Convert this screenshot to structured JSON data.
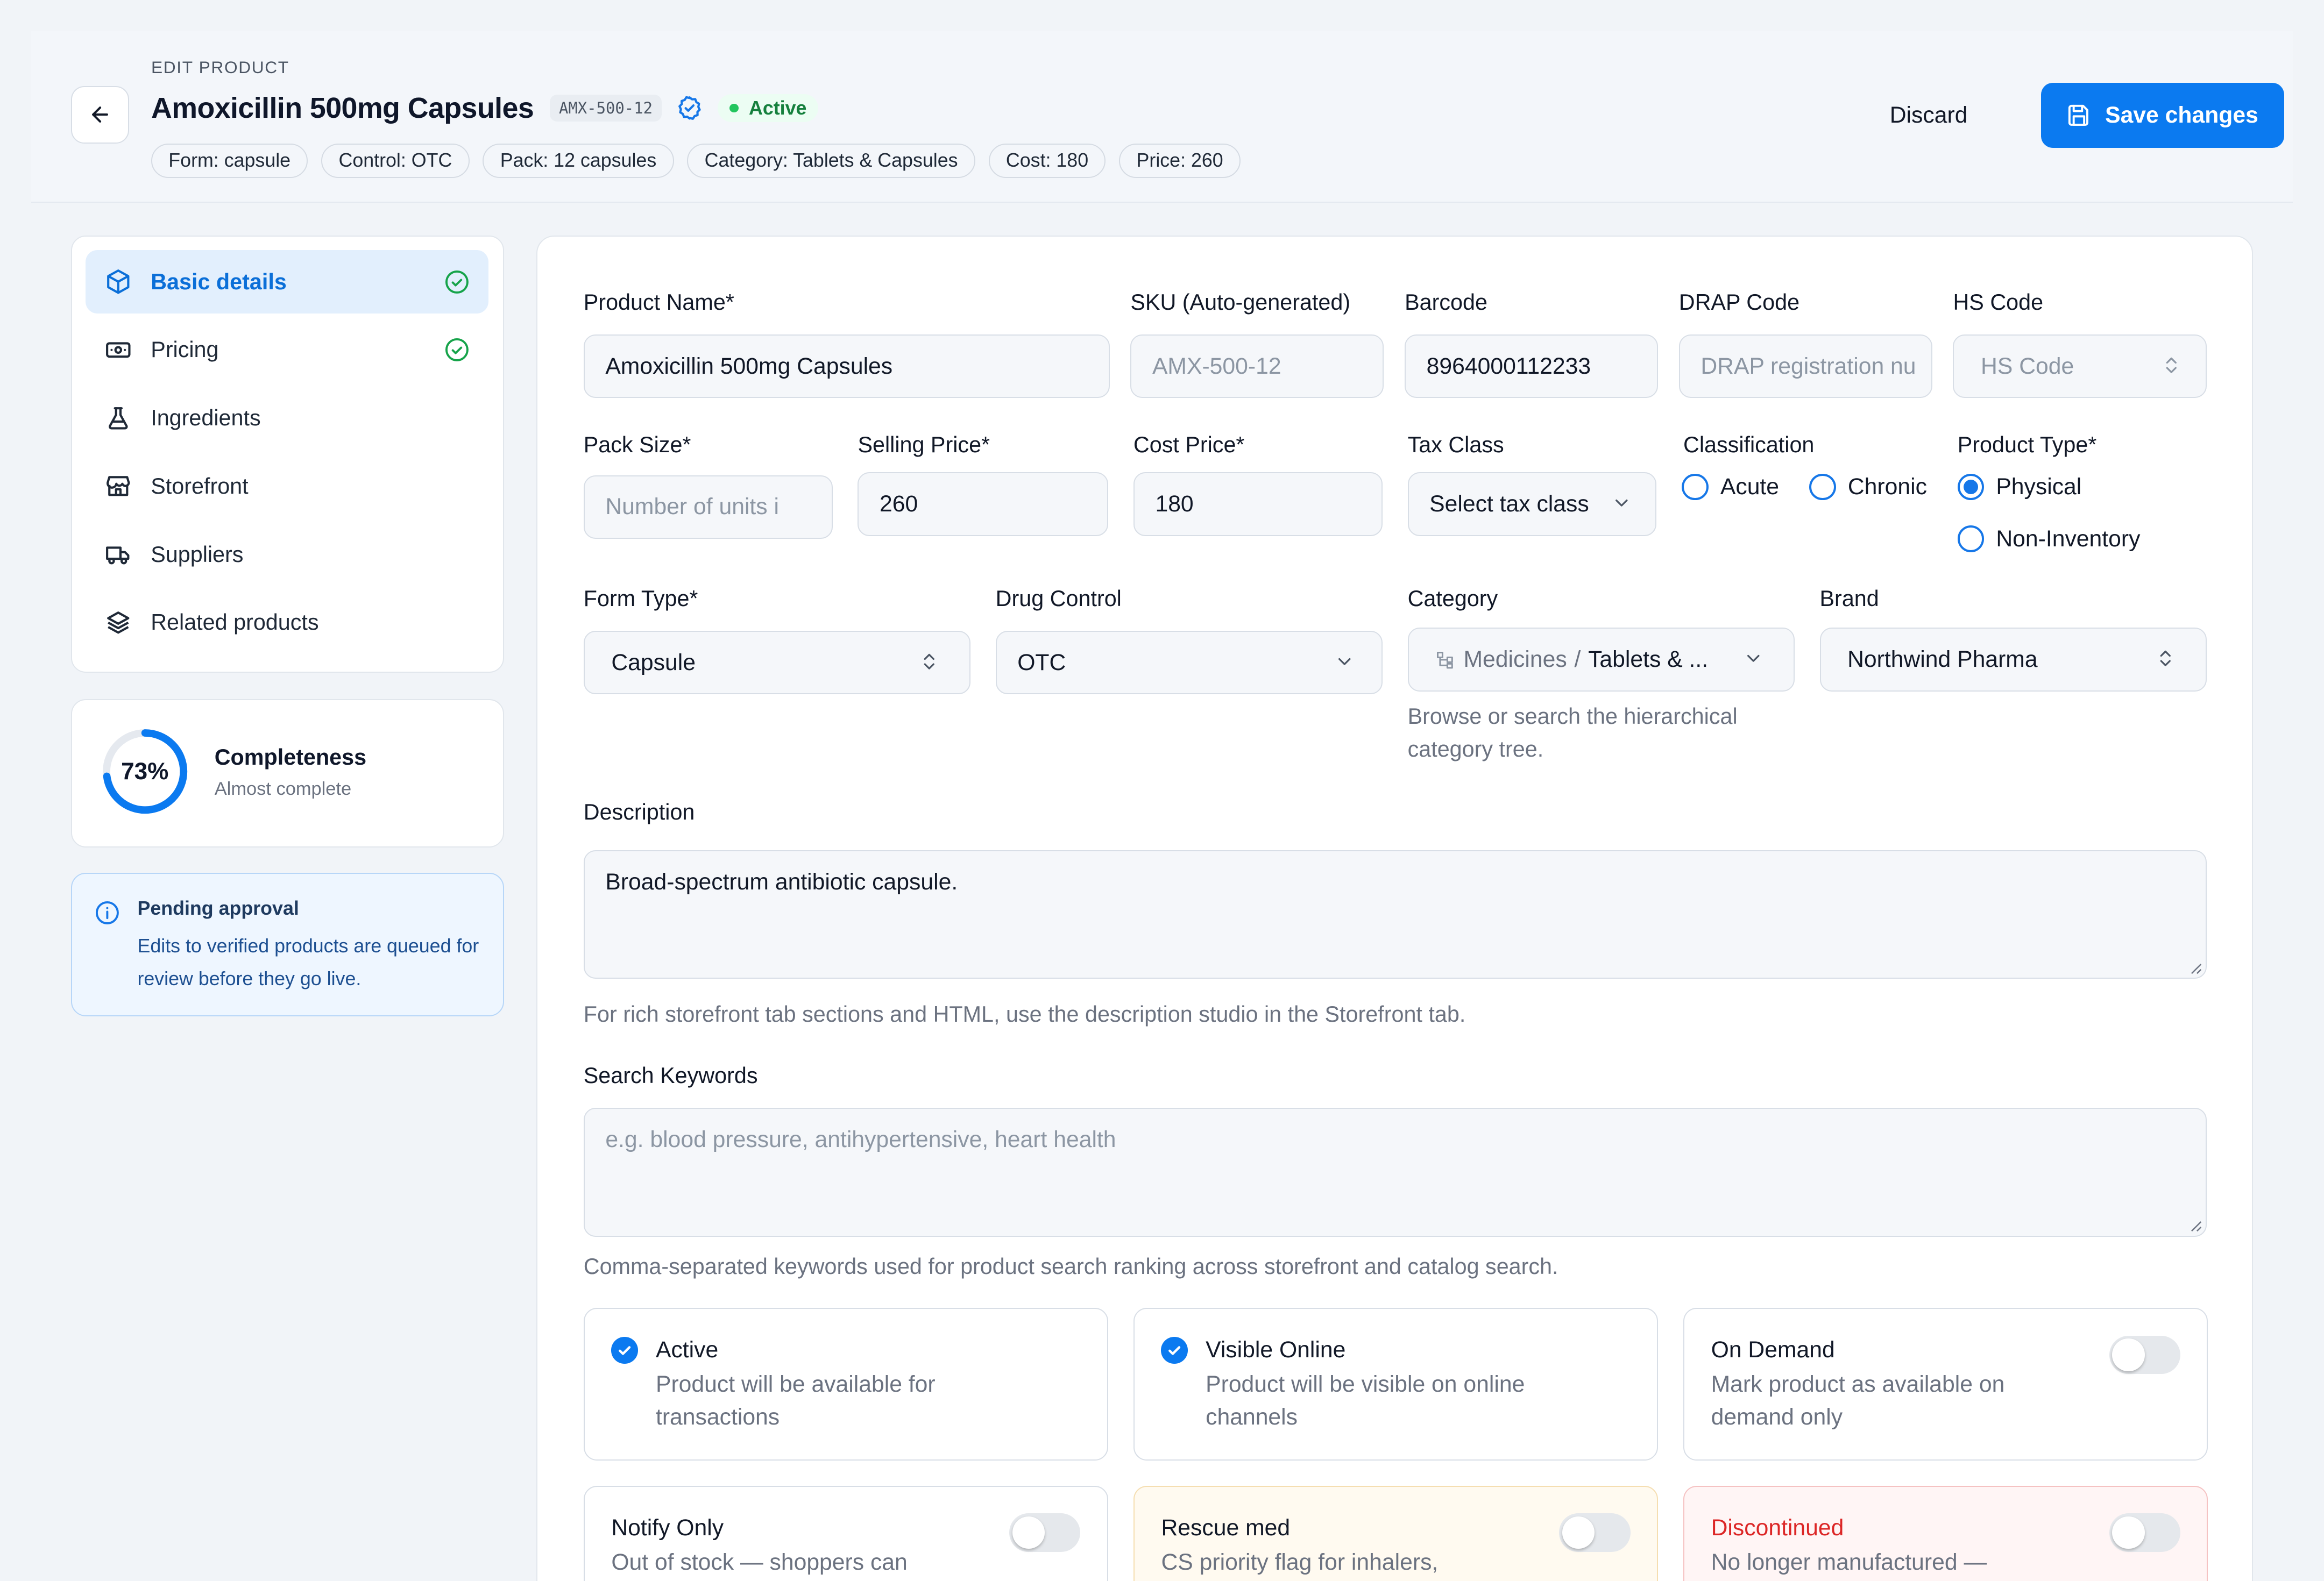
{
  "header": {
    "eyebrow": "EDIT PRODUCT",
    "title": "Amoxicillin 500mg Capsules",
    "sku_badge": "AMX-500-12",
    "status": "Active",
    "chips": [
      "Form: capsule",
      "Control: OTC",
      "Pack: 12 capsules",
      "Category: Tablets & Capsules",
      "Cost: 180",
      "Price: 260"
    ],
    "discard_label": "Discard",
    "save_label": "Save changes",
    "icons": {
      "back": "arrow-left-icon",
      "verified": "verified-badge-icon",
      "save": "save-disk-icon"
    }
  },
  "sidebar": {
    "items": [
      {
        "label": "Basic details",
        "icon": "cube-icon",
        "active": true,
        "complete": true
      },
      {
        "label": "Pricing",
        "icon": "banknote-icon",
        "active": false,
        "complete": true
      },
      {
        "label": "Ingredients",
        "icon": "flask-icon",
        "active": false,
        "complete": false
      },
      {
        "label": "Storefront",
        "icon": "store-icon",
        "active": false,
        "complete": false
      },
      {
        "label": "Suppliers",
        "icon": "truck-icon",
        "active": false,
        "complete": false
      },
      {
        "label": "Related products",
        "icon": "layers-icon",
        "active": false,
        "complete": false
      }
    ]
  },
  "completeness": {
    "percent_label": "73%",
    "percent": 73,
    "title": "Completeness",
    "subtitle": "Almost complete"
  },
  "pending": {
    "title": "Pending approval",
    "text": "Edits to verified products are queued for review before they go live."
  },
  "form": {
    "product_name": {
      "label": "Product Name*",
      "value": "Amoxicillin 500mg Capsules"
    },
    "sku": {
      "label": "SKU (Auto-generated)",
      "placeholder": "AMX-500-12"
    },
    "barcode": {
      "label": "Barcode",
      "value": "8964000112233"
    },
    "drap": {
      "label": "DRAP Code",
      "placeholder": "DRAP registration nu"
    },
    "hs": {
      "label": "HS Code",
      "placeholder": "HS Code"
    },
    "pack_size": {
      "label": "Pack Size*",
      "placeholder": "Number of units i"
    },
    "selling_price": {
      "label": "Selling Price*",
      "value": "260"
    },
    "cost_price": {
      "label": "Cost Price*",
      "value": "180"
    },
    "tax_class": {
      "label": "Tax Class",
      "value": "Select tax class"
    },
    "classification": {
      "label": "Classification",
      "options": [
        "Acute",
        "Chronic"
      ],
      "selected": null
    },
    "product_type": {
      "label": "Product Type*",
      "options": [
        "Physical",
        "Non-Inventory"
      ],
      "selected": "Physical"
    },
    "form_type": {
      "label": "Form Type*",
      "value": "Capsule"
    },
    "drug_control": {
      "label": "Drug Control",
      "value": "OTC"
    },
    "category": {
      "label": "Category",
      "path_root": "Medicines",
      "separator": "/",
      "path_leaf": "Tablets & ...",
      "helper": "Browse or search the hierarchical category tree."
    },
    "brand": {
      "label": "Brand",
      "value": "Northwind Pharma"
    },
    "description": {
      "label": "Description",
      "value": "Broad-spectrum antibiotic capsule.",
      "helper": "For rich storefront tab sections and HTML, use the description studio in the Storefront tab."
    },
    "keywords": {
      "label": "Search Keywords",
      "placeholder": "e.g. blood pressure, antihypertensive, heart health",
      "helper": "Comma-separated keywords used for product search ranking across storefront and catalog search."
    }
  },
  "options": [
    {
      "title": "Active",
      "desc": "Product will be available for transactions",
      "checked": true
    },
    {
      "title": "Visible Online",
      "desc": "Product will be visible on online channels",
      "checked": true
    },
    {
      "title": "On Demand",
      "desc": "Mark product as available on demand only",
      "checked": false
    },
    {
      "title": "Notify Only",
      "desc": "Out of stock — shoppers can",
      "checked": false
    },
    {
      "title": "Rescue med",
      "desc": "CS priority flag for inhalers,",
      "checked": false
    },
    {
      "title": "Discontinued",
      "desc": "No longer manufactured —",
      "checked": false
    }
  ],
  "colors": {
    "accent": "#0b7af0",
    "success": "#16a34a",
    "danger": "#dc2626",
    "warning_bg": "#fffaf0"
  }
}
